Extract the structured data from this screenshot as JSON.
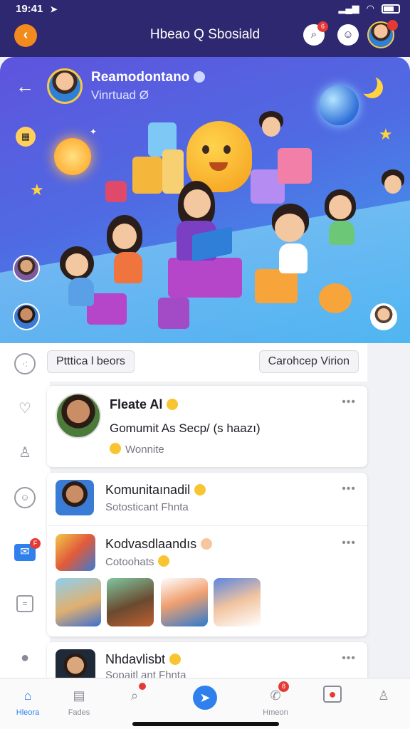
{
  "status_bar": {
    "time": "19:41",
    "arrow": "➤"
  },
  "header": {
    "title": "Hbeao Q Sbosiald",
    "back_glyph": "‹"
  },
  "hero": {
    "name": "Reamodontano",
    "subtitle": "Vinrtuad"
  },
  "chips": [
    "Ptttica l beors",
    "Carohcep Virion"
  ],
  "posts": [
    {
      "title": "Fleate Al",
      "body": "Gomumit As Secp/ (s haazı)",
      "meta": "Wonnite"
    },
    {
      "title": "Komunitaınadil",
      "meta": "Sotosticant Fhnta"
    },
    {
      "title": "Kodvasdlaandıs",
      "meta": "Cotoohats"
    },
    {
      "title": "Nhdavlisbt",
      "meta": "Sopaitl ant Fhnta"
    }
  ],
  "more_glyph": "•••",
  "bottom_nav": [
    {
      "label": "Hleora",
      "icon": "home-icon"
    },
    {
      "label": "Fades",
      "icon": "calendar-icon"
    },
    {
      "label": "",
      "icon": "search-icon"
    },
    {
      "label": "",
      "icon": "send-icon"
    },
    {
      "label": "Hmeon",
      "icon": "notifications-icon"
    },
    {
      "label": "",
      "icon": "record-icon"
    },
    {
      "label": "",
      "icon": "profile-icon"
    }
  ],
  "colors": {
    "header_bg": "#2e2870",
    "accent_orange": "#f28a1d",
    "accent_blue": "#2f80ed",
    "badge_red": "#e53935"
  }
}
